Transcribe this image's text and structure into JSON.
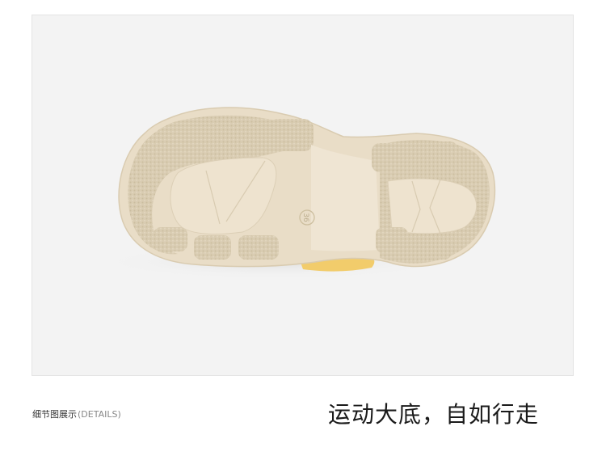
{
  "caption": {
    "label_cn": "细节图展示",
    "label_en": "(DETAILS)"
  },
  "headline": "运动大底，自如行走",
  "photo": {
    "sole_size_mark": "36"
  },
  "colors": {
    "page_background": "#ffffff",
    "photo_background": "#f3f3f3",
    "sole": "#e8dcc6",
    "tread": "#dccfb6",
    "upper_accent": "#f2cc6b"
  }
}
